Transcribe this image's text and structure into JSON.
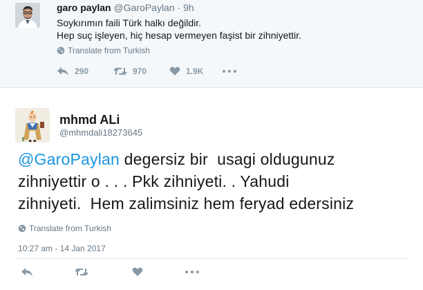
{
  "parent_tweet": {
    "name": "garo paylan",
    "handle": "@GaroPaylan",
    "separator": "·",
    "time": "9h",
    "text_lines": [
      "Soykırımın faili Türk halkı değildir.",
      "Hep suç işleyen, hiç hesap vermeyen faşist bir zihniyettir."
    ],
    "translate": "Translate from Turkish",
    "actions": {
      "reply_count": "290",
      "retweet_count": "970",
      "like_count": "1.9K"
    }
  },
  "reply_tweet": {
    "name": "mhmd ALi",
    "handle": "@mhmdali18273645",
    "mention": "@GaroPaylan",
    "text_lines": [
      " degersiz bir  usagi oldugunuz",
      "zihniyettir o . . . Pkk zihniyeti. . Yahudi",
      "zihniyeti.  Hem zalimsiniz hem feryad edersiniz"
    ],
    "translate": "Translate from Turkish",
    "timestamp": "10:27 am - 14 Jan 2017"
  },
  "icons": [
    "reply-icon",
    "retweet-icon",
    "like-icon",
    "more-icon",
    "globe-icon"
  ],
  "colors": {
    "link": "#1b95e0",
    "muted": "#657786",
    "icon": "#8899a6",
    "parent_bg": "#f5f8fa"
  }
}
